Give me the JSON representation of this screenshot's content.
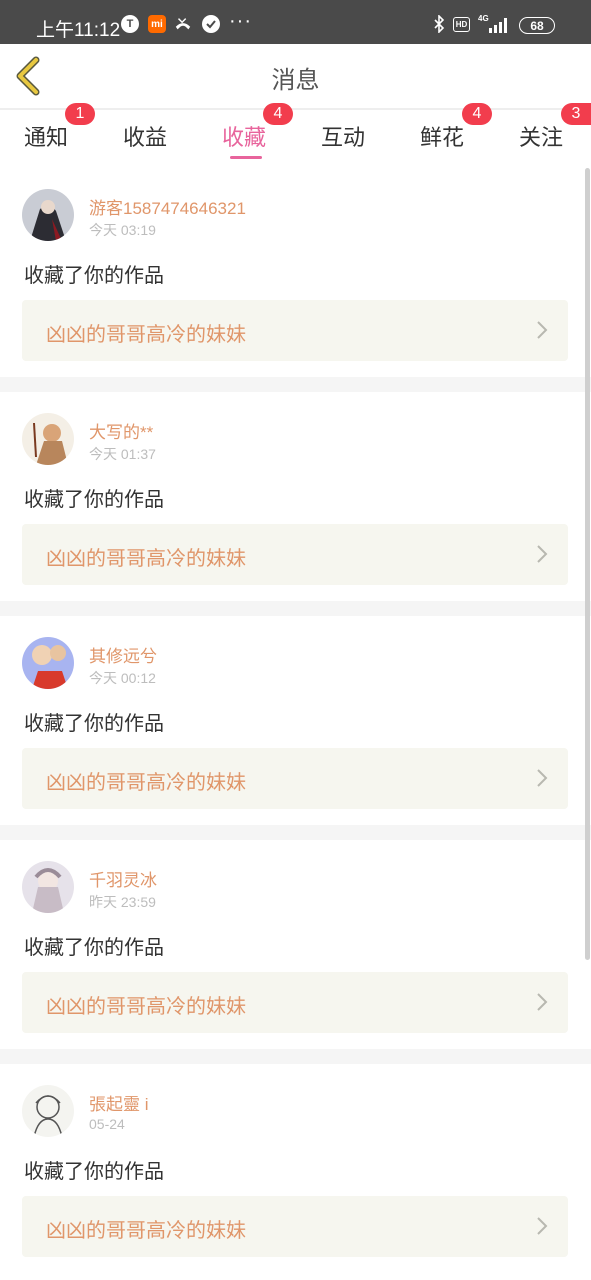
{
  "status_bar": {
    "time": "上午11:12",
    "icons": [
      "t-app-icon",
      "mi-icon",
      "missed-call-icon",
      "check-circle-icon",
      "more-dots-icon",
      "bluetooth-icon",
      "hd-icon",
      "signal-4g-icon",
      "battery-icon"
    ],
    "t_label": "T",
    "mi_label": "mi",
    "dots": "···",
    "hd_label": "HD",
    "network": "4G",
    "battery": "68"
  },
  "header": {
    "title": "消息",
    "back_icon": "chevron-left-icon",
    "accent_color": "#e8c840"
  },
  "tabs": [
    {
      "label": "通知",
      "badge": "1"
    },
    {
      "label": "收益",
      "badge": ""
    },
    {
      "label": "收藏",
      "badge": "4",
      "active": true
    },
    {
      "label": "互动",
      "badge": ""
    },
    {
      "label": "鲜花",
      "badge": "4"
    },
    {
      "label": "关注",
      "badge": "3"
    }
  ],
  "colors": {
    "active_tab": "#e8649c",
    "badge": "#f23d4d",
    "username": "#e0966a",
    "work_title": "#e0966a",
    "work_bg": "#f6f6ef"
  },
  "items": [
    {
      "username": "游客1587474646321",
      "time": "今天 03:19",
      "action": "收藏了你的作品",
      "work_title": "凶凶的哥哥高冷的妹妹"
    },
    {
      "username": "大写的**",
      "time": "今天 01:37",
      "action": "收藏了你的作品",
      "work_title": "凶凶的哥哥高冷的妹妹"
    },
    {
      "username": "其修远兮",
      "time": "今天 00:12",
      "action": "收藏了你的作品",
      "work_title": "凶凶的哥哥高冷的妹妹"
    },
    {
      "username": "千羽灵冰",
      "time": "昨天 23:59",
      "action": "收藏了你的作品",
      "work_title": "凶凶的哥哥高冷的妹妹"
    },
    {
      "username": "張起靈 i",
      "time": "05-24",
      "action": "收藏了你的作品",
      "work_title": "凶凶的哥哥高冷的妹妹"
    }
  ]
}
